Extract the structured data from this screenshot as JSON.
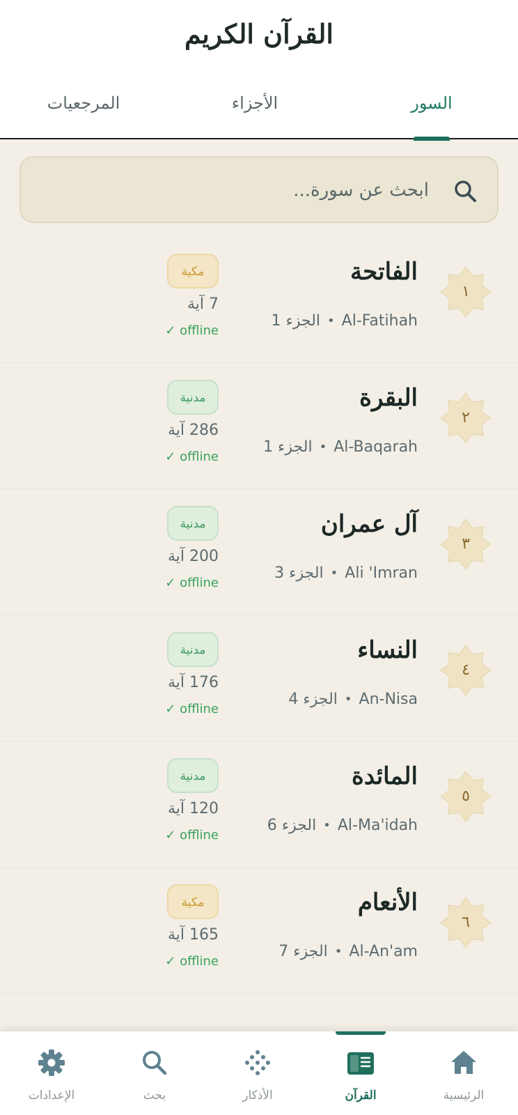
{
  "header": {
    "title": "القرآن الكريم",
    "tabs": [
      {
        "id": "surahs",
        "label": "السور",
        "active": true
      },
      {
        "id": "juz",
        "label": "الأجزاء",
        "active": false
      },
      {
        "id": "references",
        "label": "المرجعيات",
        "active": false
      }
    ]
  },
  "search": {
    "placeholder": "ابحث عن سورة...",
    "icon": "search-icon"
  },
  "surahs": [
    {
      "number": "١",
      "name_ar": "الفاتحة",
      "name_en": "Al-Fatihah",
      "juz": "الجزء 1",
      "type": "مكية",
      "type_kind": "makki",
      "ayat": "7 آية",
      "status": "✓ offline"
    },
    {
      "number": "٢",
      "name_ar": "البقرة",
      "name_en": "Al-Baqarah",
      "juz": "الجزء 1",
      "type": "مدنية",
      "type_kind": "madani",
      "ayat": "286 آية",
      "status": "✓ offline"
    },
    {
      "number": "٣",
      "name_ar": "آل عمران",
      "name_en": "Ali 'Imran",
      "juz": "الجزء 3",
      "type": "مدنية",
      "type_kind": "madani",
      "ayat": "200 آية",
      "status": "✓ offline"
    },
    {
      "number": "٤",
      "name_ar": "النساء",
      "name_en": "An-Nisa",
      "juz": "الجزء 4",
      "type": "مدنية",
      "type_kind": "madani",
      "ayat": "176 آية",
      "status": "✓ offline"
    },
    {
      "number": "٥",
      "name_ar": "المائدة",
      "name_en": "Al-Ma'idah",
      "juz": "الجزء 6",
      "type": "مدنية",
      "type_kind": "madani",
      "ayat": "120 آية",
      "status": "✓ offline"
    },
    {
      "number": "٦",
      "name_ar": "الأنعام",
      "name_en": "Al-An'am",
      "juz": "الجزء 7",
      "type": "مكية",
      "type_kind": "makki",
      "ayat": "165 آية",
      "status": "✓ offline"
    }
  ],
  "bottom_nav": [
    {
      "id": "settings",
      "label": "الإعدادات",
      "icon": "gear-icon",
      "active": false
    },
    {
      "id": "search",
      "label": "بحث",
      "icon": "search-icon",
      "active": false
    },
    {
      "id": "adhkar",
      "label": "الأذكار",
      "icon": "dots-icon",
      "active": false
    },
    {
      "id": "quran",
      "label": "القرآن",
      "icon": "book-icon",
      "active": true
    },
    {
      "id": "home",
      "label": "الرئيسية",
      "icon": "home-icon",
      "active": false
    }
  ],
  "colors": {
    "accent": "#1f6f5c",
    "background": "#f3efe6",
    "makki": "#c89a2f",
    "madani": "#3d9a5f"
  }
}
